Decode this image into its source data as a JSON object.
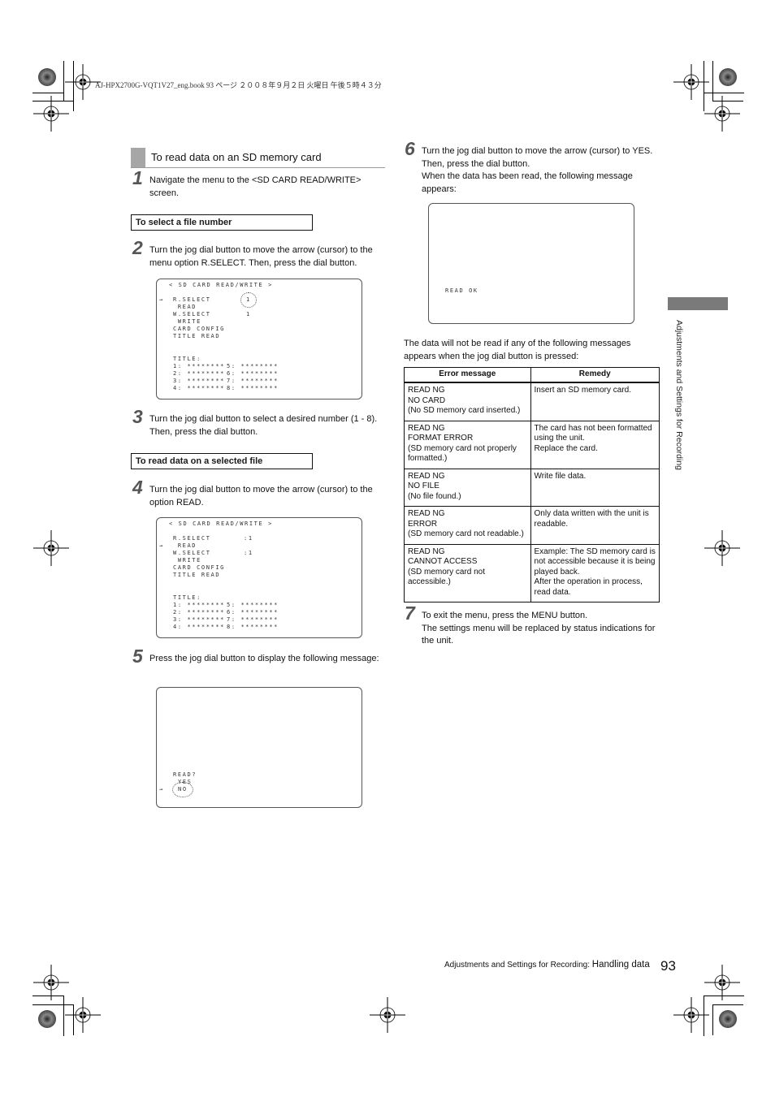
{
  "header": {
    "file_line": "AJ-HPX2700G-VQT1V27_eng.book  93 ページ  ２００８年９月２日  火曜日  午後５時４３分"
  },
  "section": {
    "title": "To read data on an SD memory card"
  },
  "steps": [
    {
      "num": "1",
      "text": "Navigate the menu to the <SD CARD READ/WRITE> screen."
    },
    {
      "num": "2",
      "text": "Turn the jog dial button to move the arrow (cursor) to the menu option R.SELECT. Then, press the dial button."
    },
    {
      "num": "3",
      "text": "Turn the jog dial button to select a desired number (1 - 8). Then, press the dial button."
    },
    {
      "num": "4",
      "text": "Turn the jog dial button to move the arrow (cursor) to the option READ."
    },
    {
      "num": "5",
      "text": "Press the jog dial button to display the following message:"
    },
    {
      "num": "6",
      "text": "Turn the jog dial button to move the arrow (cursor) to YES. Then, press the dial button.",
      "text2": "When the data has been read, the following message appears:"
    },
    {
      "num": "7",
      "text": "To exit the menu, press the MENU button.",
      "text2": "The settings menu will be replaced by status indications for the unit."
    }
  ],
  "subheads": {
    "select_file": "To select a file number",
    "read_file": "To read data on a selected file"
  },
  "screen1": {
    "title": "< SD CARD READ/WRITE >",
    "cursor": "→",
    "items": [
      "R.SELECT",
      " READ",
      "W.SELECT",
      " WRITE",
      "CARD CONFIG",
      "TITLE READ"
    ],
    "r_select_value": "1",
    "w_select_value": "1",
    "title_label": "TITLE:",
    "titles": [
      "1: ********",
      "2: ********",
      "3: ********",
      "4: ********",
      "5: ********",
      "6: ********",
      "7: ********",
      "8: ********"
    ]
  },
  "screen2": {
    "title": "< SD CARD READ/WRITE >",
    "cursor": "→",
    "items": [
      "R.SELECT",
      " READ",
      "W.SELECT",
      " WRITE",
      "CARD CONFIG",
      "TITLE READ"
    ],
    "r_select_value": ":1",
    "w_select_value": ":1",
    "title_label": "TITLE:",
    "titles": [
      "1: ********",
      "2: ********",
      "3: ********",
      "4: ********",
      "5: ********",
      "6: ********",
      "7: ********",
      "8: ********"
    ]
  },
  "screen3": {
    "prompt": "READ?",
    "yes": "YES",
    "no": "NO",
    "cursor": "→"
  },
  "screen4": {
    "message": "READ OK"
  },
  "note": "The data will not be read if any of the following messages appears when the jog dial button is pressed:",
  "error_table": {
    "headers": [
      "Error message",
      "Remedy"
    ],
    "rows": [
      {
        "message": [
          "READ NG",
          "NO CARD",
          "(No SD memory card inserted.)"
        ],
        "remedy": [
          "Insert an SD memory card."
        ]
      },
      {
        "message": [
          "READ NG",
          "FORMAT ERROR",
          "(SD memory card not properly formatted.)"
        ],
        "remedy": [
          "The card has not been formatted using the unit.",
          "Replace the card."
        ]
      },
      {
        "message": [
          "READ NG",
          "NO FILE",
          "(No file found.)"
        ],
        "remedy": [
          "Write file data."
        ]
      },
      {
        "message": [
          "READ NG",
          "ERROR",
          "(SD memory card not readable.)"
        ],
        "remedy": [
          "Only data written with the unit is readable."
        ]
      },
      {
        "message": [
          "READ NG",
          "CANNOT ACCESS",
          "(SD memory card not accessible.)"
        ],
        "remedy": [
          "Example: The SD memory card is not accessible because it is being played back.",
          "After the operation in process, read data."
        ]
      }
    ]
  },
  "side_tab": "Adjustments and Settings for Recording",
  "footer": {
    "chapter": "Adjustments and Settings for Recording: ",
    "topic": "Handling data",
    "page": "93"
  }
}
